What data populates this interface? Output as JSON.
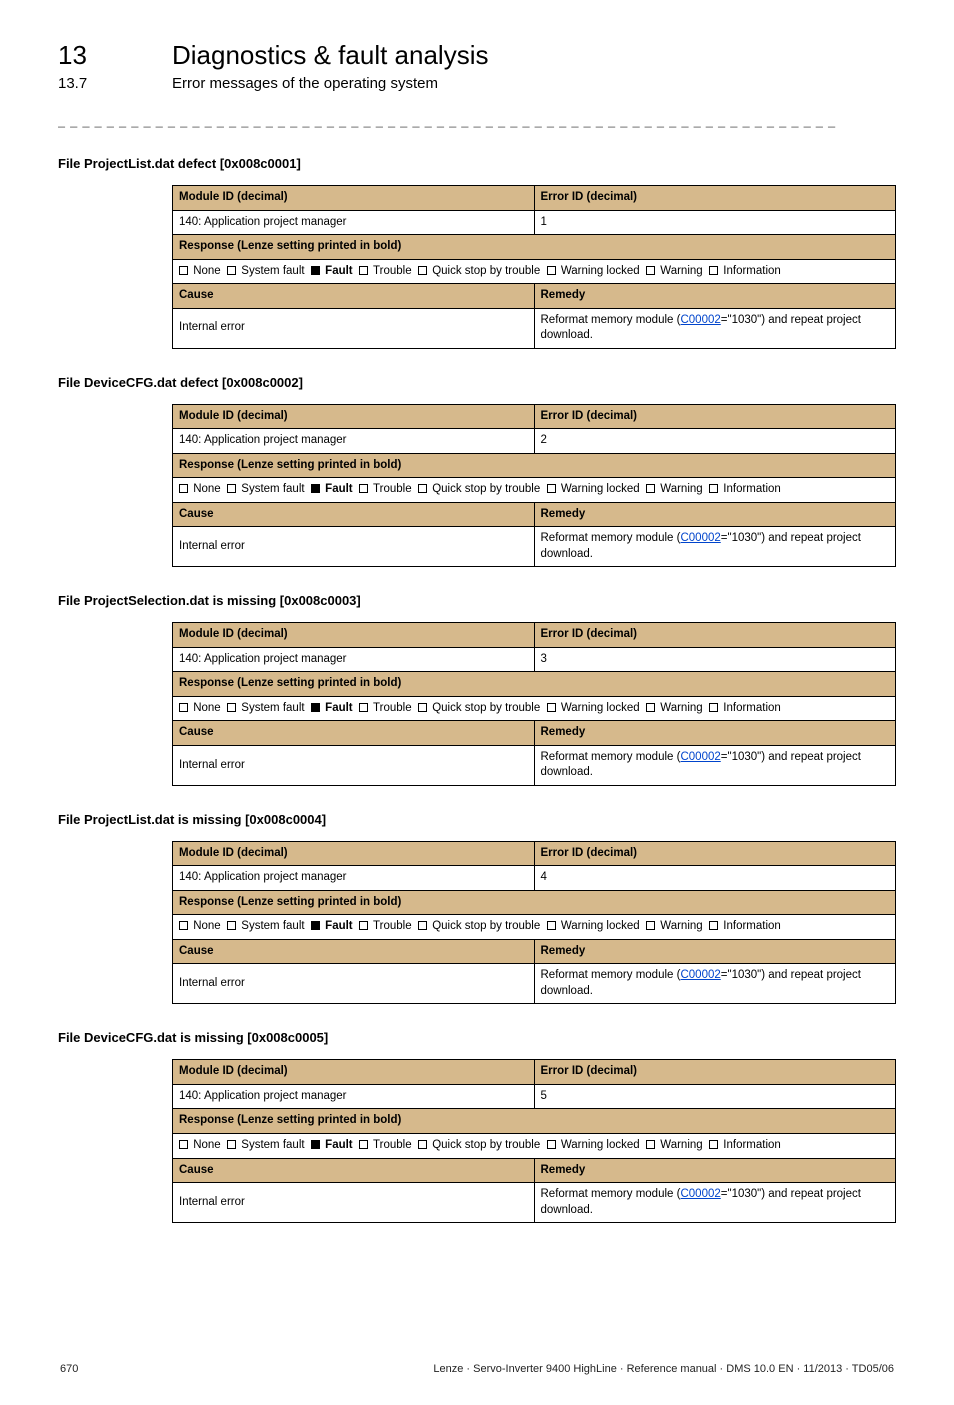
{
  "chapter": {
    "num": "13",
    "title": "Diagnostics & fault analysis"
  },
  "section": {
    "num": "13.7",
    "title": "Error messages of the operating system"
  },
  "dashline": "_ _ _ _ _ _ _ _ _ _ _ _ _ _ _ _ _ _ _ _ _ _ _ _ _ _ _ _ _ _ _ _ _ _ _ _ _ _ _ _ _ _ _ _ _ _ _ _ _ _ _ _ _ _ _ _ _ _ _ _ _ _ _ _",
  "labels": {
    "module_id": "Module ID (decimal)",
    "error_id": "Error ID (decimal)",
    "module_name": "140: Application project manager",
    "response_hdr": "Response (Lenze setting printed in bold)",
    "cause": "Cause",
    "remedy": "Remedy",
    "internal_error": "Internal error",
    "reformat_pre": "Reformat memory module (",
    "reformat_link": "C00002",
    "reformat_post": "=\"1030\") and repeat project download.",
    "resp_none": "None",
    "resp_sysfault": "System fault",
    "resp_fault": "Fault",
    "resp_trouble": "Trouble",
    "resp_quick": "Quick stop by trouble",
    "resp_warnlock": "Warning locked",
    "resp_warn": "Warning",
    "resp_info": "Information"
  },
  "blocks": [
    {
      "title": "File ProjectList.dat defect [0x008c0001]",
      "errid": "1"
    },
    {
      "title": "File DeviceCFG.dat defect [0x008c0002]",
      "errid": "2"
    },
    {
      "title": "File ProjectSelection.dat is missing [0x008c0003]",
      "errid": "3"
    },
    {
      "title": "File ProjectList.dat is missing [0x008c0004]",
      "errid": "4"
    },
    {
      "title": "File DeviceCFG.dat is missing [0x008c0005]",
      "errid": "5"
    }
  ],
  "footer": {
    "page": "670",
    "right": "Lenze · Servo-Inverter 9400 HighLine · Reference manual · DMS 10.0 EN · 11/2013 · TD05/06"
  }
}
